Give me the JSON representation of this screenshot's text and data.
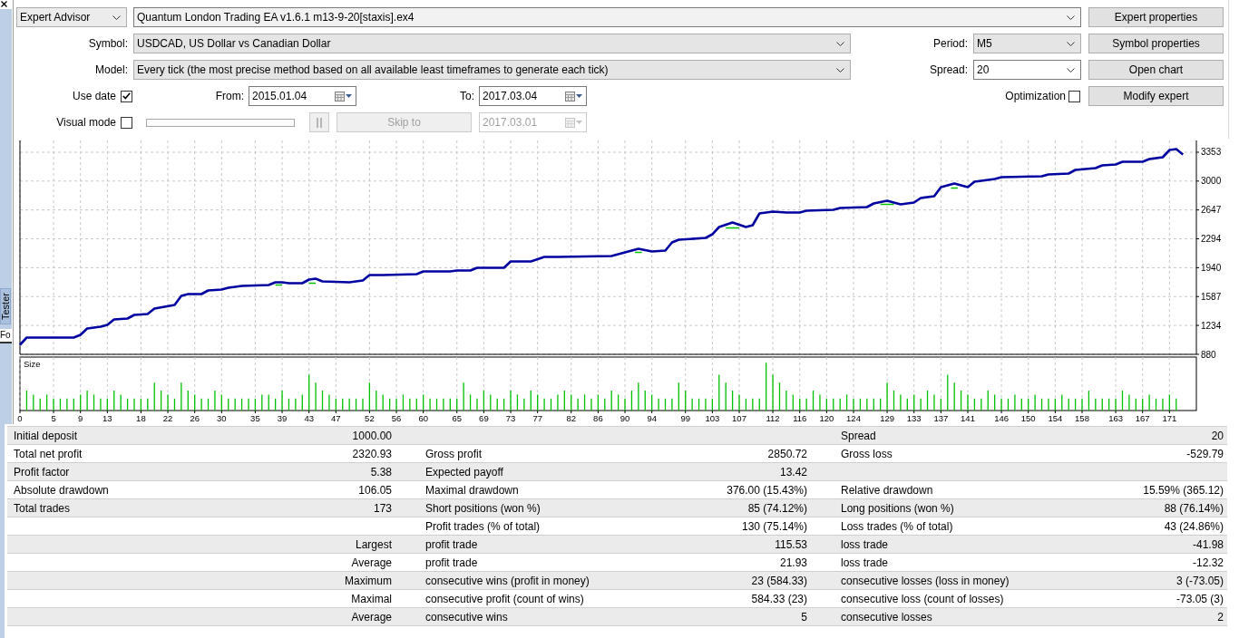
{
  "dock_bar": {
    "title": "Tester",
    "tab_label": "Fo"
  },
  "settings": {
    "program_type": {
      "value": "Expert Advisor"
    },
    "expert": {
      "value": "Quantum London Trading EA v1.6.1 m13-9-20[staxis].ex4"
    },
    "symbol": {
      "label": "Symbol:",
      "value": "USDCAD, US Dollar vs Canadian Dollar"
    },
    "period": {
      "label": "Period:",
      "value": "M5"
    },
    "model": {
      "label": "Model:",
      "value": "Every tick (the most precise method based on all available least timeframes to generate each tick)"
    },
    "spread": {
      "label": "Spread:",
      "value": "20"
    },
    "use_date": {
      "label": "Use date",
      "checked": true
    },
    "from": {
      "label": "From:",
      "value": "2015.01.04"
    },
    "to": {
      "label": "To:",
      "value": "2017.03.04"
    },
    "optimization": {
      "label": "Optimization",
      "checked": false
    },
    "visual_mode": {
      "label": "Visual mode",
      "checked": false
    },
    "pause_button": {
      "disabled": true
    },
    "skip_button": {
      "label": "Skip to",
      "disabled": true
    },
    "skip_date": {
      "value": "2017.03.01",
      "disabled": true
    },
    "buttons": [
      {
        "label": "Expert properties"
      },
      {
        "label": "Symbol properties"
      },
      {
        "label": "Open chart"
      },
      {
        "label": "Modify expert"
      }
    ]
  },
  "chart": {
    "chart_data": [
      {
        "type": "line",
        "grid": true,
        "xlim": [
          0,
          175
        ],
        "ylim": [
          880,
          3497
        ],
        "xticks": [
          0,
          5,
          9,
          13,
          18,
          22,
          26,
          30,
          35,
          39,
          43,
          47,
          52,
          56,
          60,
          65,
          69,
          73,
          77,
          82,
          86,
          90,
          94,
          99,
          103,
          107,
          112,
          116,
          120,
          124,
          129,
          133,
          137,
          141,
          146,
          150,
          154,
          158,
          163,
          167,
          171
        ],
        "yticks": [
          880,
          1234,
          1587,
          1940,
          2294,
          2647,
          3000,
          3353
        ],
        "x": [
          0,
          1,
          8,
          9,
          10,
          12,
          13,
          14,
          16,
          17,
          19,
          20,
          23,
          24,
          25,
          27,
          28,
          30,
          31,
          33,
          37,
          38,
          39,
          40,
          42,
          43,
          44,
          45,
          49,
          50,
          51,
          52,
          54,
          59,
          60,
          64,
          65,
          67,
          68,
          72,
          73,
          76,
          78,
          80,
          88,
          89,
          90,
          92,
          94,
          96,
          97,
          98,
          102,
          103,
          104,
          106,
          108,
          109,
          110,
          112,
          114,
          116,
          117,
          121,
          122,
          126,
          127,
          129,
          131,
          133,
          134,
          136,
          137,
          139,
          141,
          142,
          145,
          146,
          152,
          153,
          156,
          157,
          160,
          161,
          163,
          164,
          167,
          168,
          170,
          171,
          172,
          173
        ],
        "series": [
          {
            "color": "#00c000",
            "x": [
              38,
              39,
              41,
              43,
              44,
              60,
              91.5,
              92.5,
              100,
              105,
              107,
              120,
              128,
              130,
              135,
              138.5,
              139.5
            ],
            "values": [
              1730,
              1730,
              null,
              1750,
              1750,
              null,
              2130,
              2130,
              null,
              2430,
              2430,
              null,
              2710,
              2710,
              null,
              2920,
              2920
            ]
          },
          {
            "color": "#0000a0",
            "values": [
              1000,
              1080,
              1090,
              1120,
              1200,
              1220,
              1240,
              1310,
              1320,
              1360,
              1370,
              1440,
              1480,
              1590,
              1620,
              1620,
              1660,
              1670,
              1700,
              1720,
              1730,
              1760,
              1760,
              1750,
              1750,
              1800,
              1810,
              1770,
              1760,
              1770,
              1780,
              1850,
              1850,
              1860,
              1890,
              1890,
              1910,
              1910,
              1940,
              1940,
              2020,
              2020,
              2070,
              2070,
              2080,
              2100,
              2130,
              2170,
              2140,
              2150,
              2250,
              2280,
              2310,
              2350,
              2440,
              2490,
              2440,
              2460,
              2600,
              2630,
              2620,
              2610,
              2640,
              2650,
              2670,
              2680,
              2730,
              2760,
              2720,
              2740,
              2790,
              2810,
              2930,
              2970,
              2930,
              2990,
              3030,
              3050,
              3060,
              3080,
              3090,
              3140,
              3160,
              3190,
              3200,
              3240,
              3240,
              3270,
              3290,
              3380,
              3390,
              3320
            ]
          }
        ]
      }
    ],
    "size_pane": {
      "label": "Size"
    }
  },
  "results": {
    "rows": [
      {
        "column_1": "Initial deposit",
        "column_2": "1000.00",
        "column_5": "Spread",
        "column_6": "20"
      },
      {
        "column_1": "Total net profit",
        "column_2": "2320.93",
        "column_3": "Gross profit",
        "column_4": "2850.72",
        "column_5": "Gross loss",
        "column_6": "-529.79"
      },
      {
        "column_1": "Profit factor",
        "column_2": "5.38",
        "column_3": "Expected payoff",
        "column_4": "13.42"
      },
      {
        "column_1": "Absolute drawdown",
        "column_2": "106.05",
        "column_3": "Maximal drawdown",
        "column_4": "376.00 (15.43%)",
        "column_5": "Relative drawdown",
        "column_6": "15.59% (365.12)"
      },
      {
        "column_1": "Total trades",
        "column_2": "173",
        "column_3": "Short positions (won %)",
        "column_4": "85 (74.12%)",
        "column_5": "Long positions (won %)",
        "column_6": "88 (76.14%)"
      },
      {
        "column_3": "Profit trades (% of total)",
        "column_4": "130 (75.14%)",
        "column_5": "Loss trades (% of total)",
        "column_6": "43 (24.86%)"
      },
      {
        "column_2": "Largest",
        "column_3": "profit trade",
        "column_4": "115.53",
        "column_5": "loss trade",
        "column_6": "-41.98"
      },
      {
        "column_2": "Average",
        "column_3": "profit trade",
        "column_4": "21.93",
        "column_5": "loss trade",
        "column_6": "-12.32"
      },
      {
        "column_2": "Maximum",
        "column_3": "consecutive wins (profit in money)",
        "column_4": "23 (584.33)",
        "column_5": "consecutive losses (loss in money)",
        "column_6": "3 (-73.05)"
      },
      {
        "column_2": "Maximal",
        "column_3": "consecutive profit (count of wins)",
        "column_4": "584.33 (23)",
        "column_5": "consecutive loss (count of losses)",
        "column_6": "-73.05 (3)"
      },
      {
        "column_2": "Average",
        "column_3": "consecutive wins",
        "column_4": "5",
        "column_5": "consecutive losses",
        "column_6": "2"
      }
    ]
  }
}
